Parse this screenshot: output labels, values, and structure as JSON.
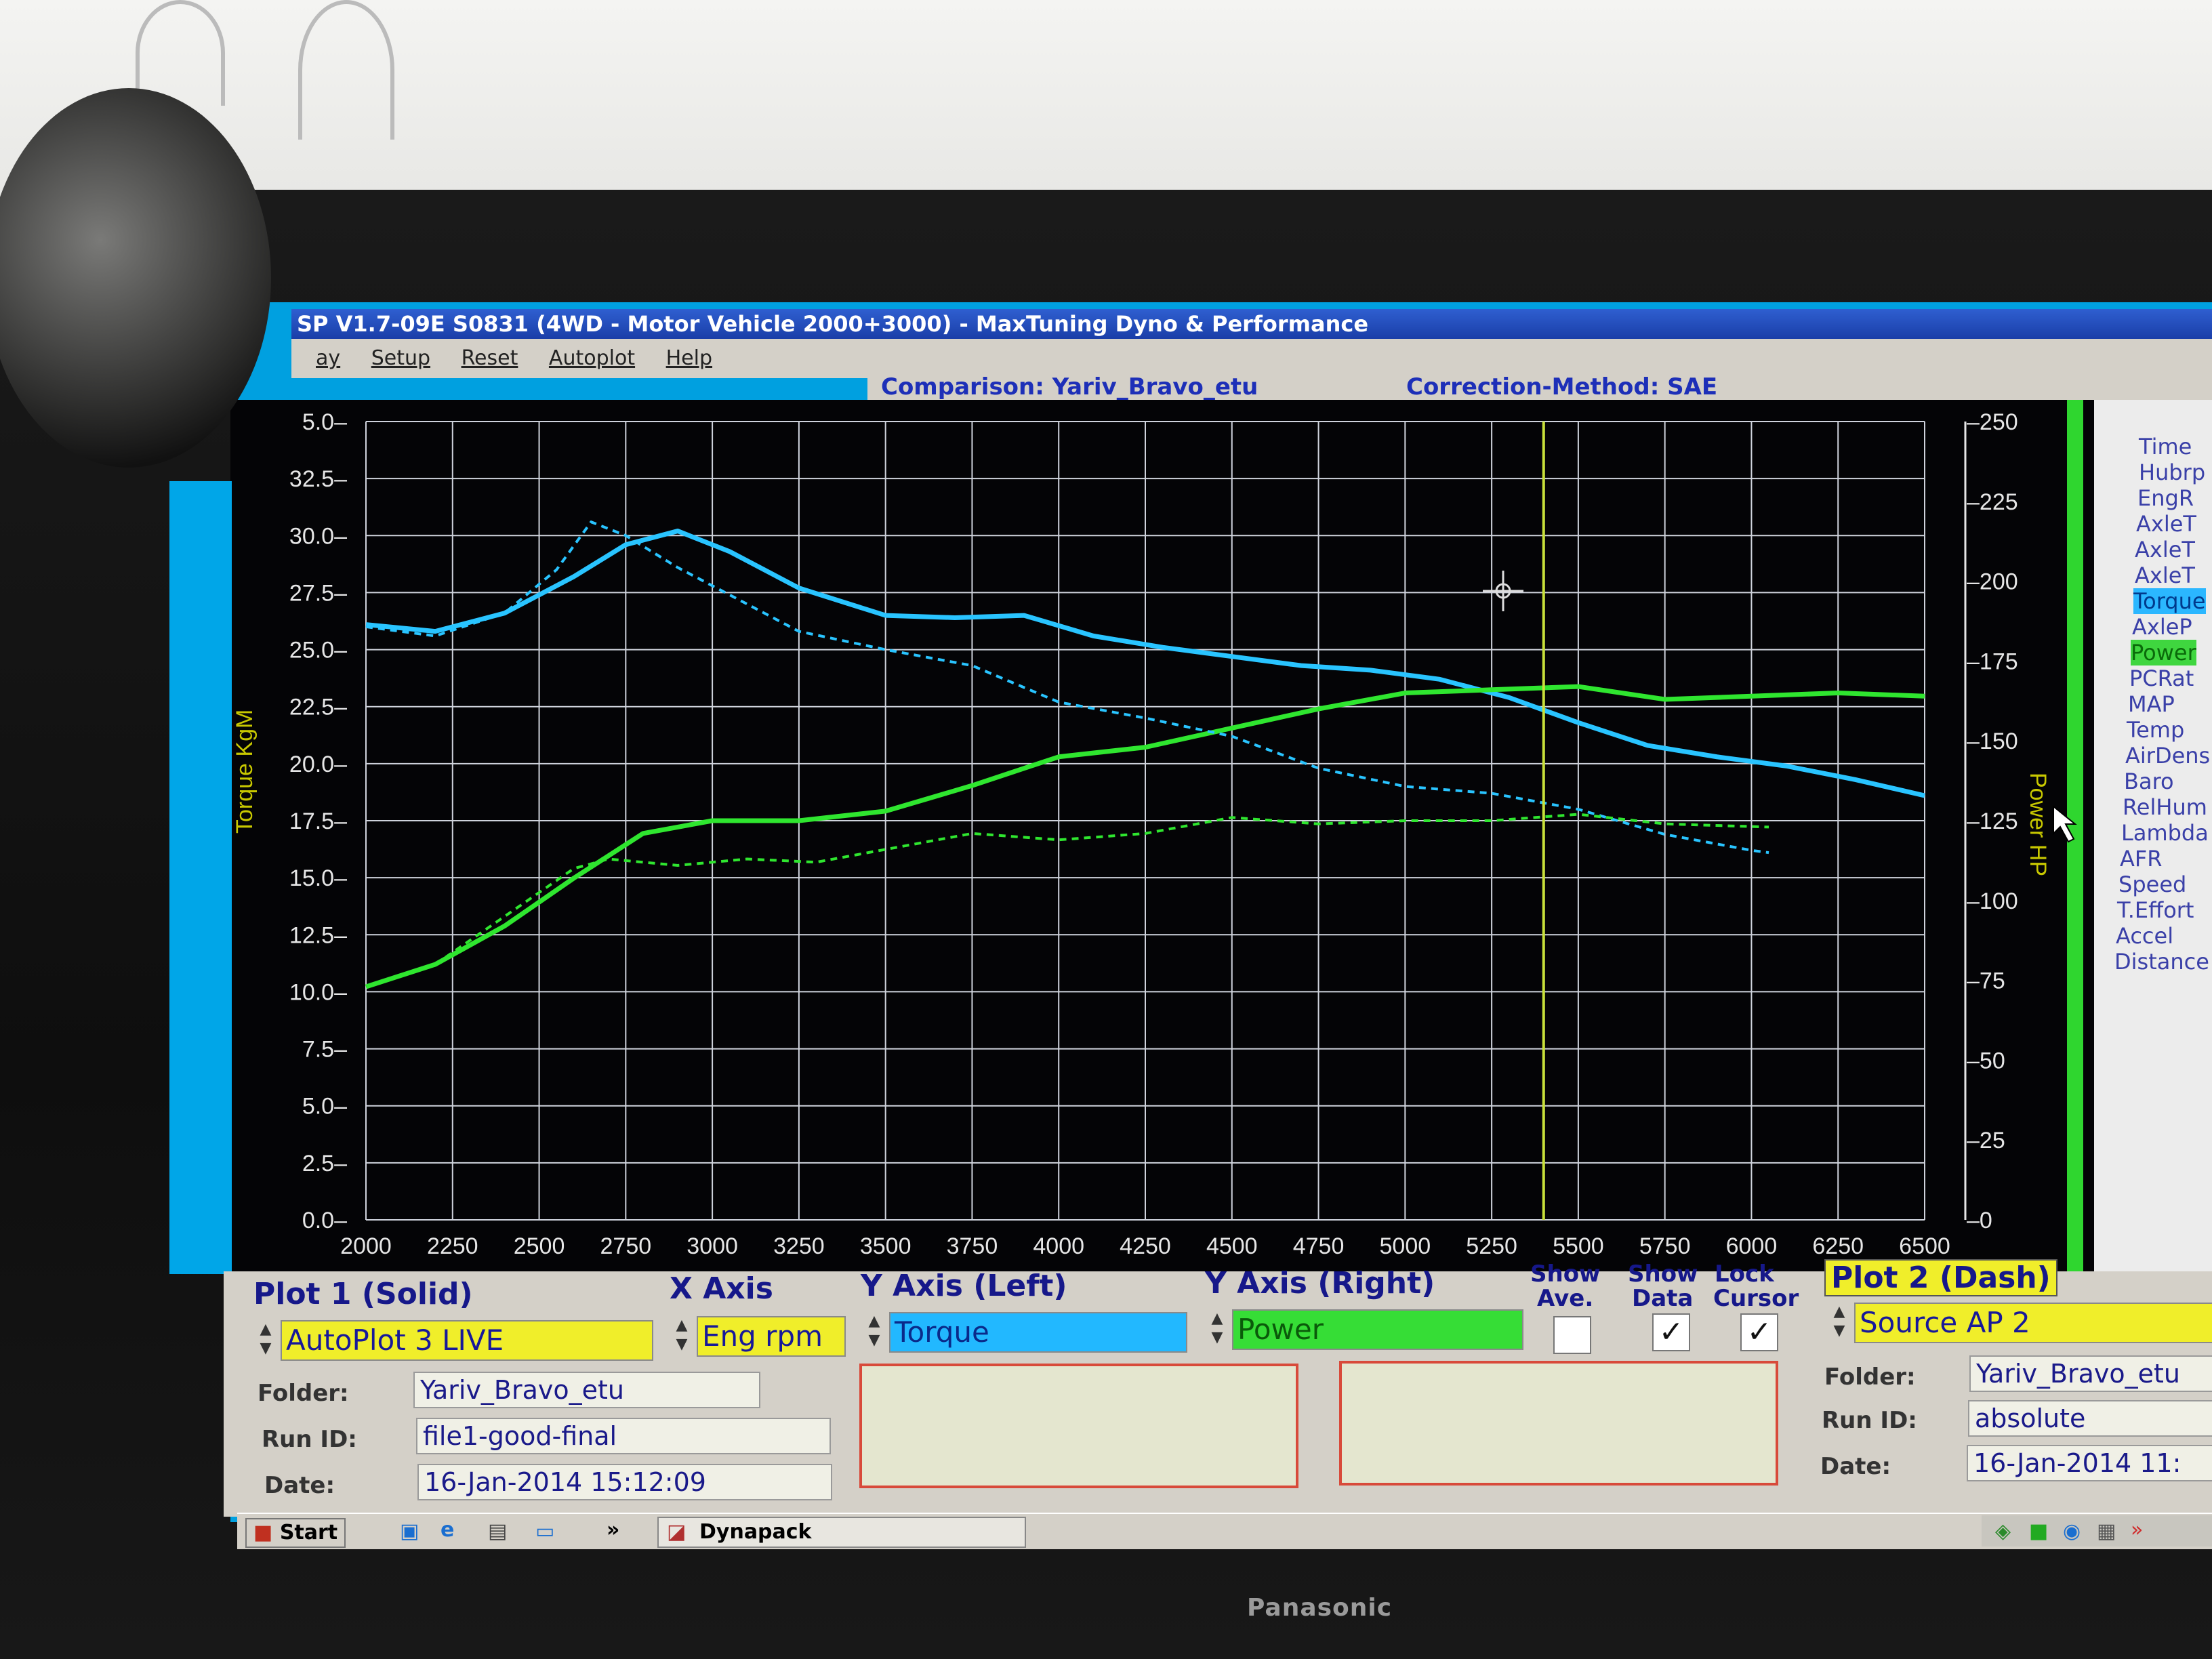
{
  "window": {
    "title": "SP V1.7-09E S0831  (4WD - Motor Vehicle 2000+3000) - MaxTuning Dyno & Performance",
    "menu": [
      "ay",
      "Setup",
      "Reset",
      "Autoplot",
      "Help"
    ]
  },
  "info": {
    "comparison": "Comparison: Yariv_Bravo_etu",
    "correction": "Correction-Method: SAE"
  },
  "channels": [
    "Time",
    "Hubrp",
    "EngR",
    "AxleT",
    "AxleT",
    "AxleT",
    "Torque",
    "AxleP",
    "Power",
    "PCRat",
    "MAP",
    "Temp",
    "AirDens",
    "Baro",
    "RelHum",
    "Lambda",
    "AFR",
    "Speed",
    "T.Effort",
    "Accel",
    "Distance"
  ],
  "chart_data": {
    "type": "line",
    "ylabel": "Torque KgM",
    "y2label": "Power HP",
    "xlim": [
      2000,
      6500
    ],
    "ylim": [
      0,
      35
    ],
    "y2lim": [
      0,
      250
    ],
    "x_ticks": [
      "2000",
      "2250",
      "2500",
      "2750",
      "3000",
      "3250",
      "3500",
      "3750",
      "4000",
      "4250",
      "4500",
      "4750",
      "5000",
      "5250",
      "5500",
      "5750",
      "6000",
      "6250",
      "6500"
    ],
    "y_ticks": [
      "0.0",
      "2.5",
      "5.0",
      "7.5",
      "10.0",
      "12.5",
      "15.0",
      "17.5",
      "20.0",
      "22.5",
      "25.0",
      "27.5",
      "30.0",
      "32.5",
      "5.0"
    ],
    "y2_ticks": [
      "0",
      "25",
      "50",
      "75",
      "100",
      "125",
      "150",
      "175",
      "200",
      "225",
      "250"
    ],
    "grid": true,
    "cursor_x": 5400,
    "colors": {
      "torque": "#29c4ff",
      "power": "#2fe62f",
      "cursor": "#c8e03a"
    },
    "series": [
      {
        "name": "Torque",
        "axis": "left",
        "style": "solid",
        "x": [
          2000,
          2200,
          2400,
          2600,
          2750,
          2900,
          3050,
          3250,
          3500,
          3700,
          3900,
          4100,
          4300,
          4500,
          4700,
          4900,
          5100,
          5300,
          5500,
          5700,
          5900,
          6100,
          6300,
          6500
        ],
        "y": [
          26.1,
          25.8,
          26.6,
          28.2,
          29.6,
          30.2,
          29.3,
          27.7,
          26.5,
          26.4,
          26.5,
          25.6,
          25.1,
          24.7,
          24.3,
          24.1,
          23.7,
          22.9,
          21.8,
          20.8,
          20.3,
          19.9,
          19.3,
          18.6
        ]
      },
      {
        "name": "Power",
        "axis": "right",
        "style": "solid",
        "x": [
          2000,
          2200,
          2400,
          2600,
          2800,
          3000,
          3250,
          3500,
          3750,
          4000,
          4250,
          4500,
          4750,
          5000,
          5250,
          5500,
          5750,
          6000,
          6250,
          6500
        ],
        "y": [
          73,
          80,
          92,
          107,
          121,
          125,
          125,
          128,
          136,
          145,
          148,
          154,
          160,
          165,
          166,
          167,
          163,
          164,
          165,
          164
        ]
      },
      {
        "name": "Torque (Plot 2)",
        "axis": "left",
        "style": "dash",
        "x": [
          2000,
          2200,
          2400,
          2550,
          2650,
          2750,
          2900,
          3050,
          3250,
          3500,
          3750,
          4000,
          4250,
          4500,
          4750,
          5000,
          5250,
          5500,
          5750,
          6000,
          6050
        ],
        "y": [
          26.0,
          25.6,
          26.6,
          28.5,
          30.6,
          30.0,
          28.6,
          27.4,
          25.8,
          25.0,
          24.3,
          22.7,
          22.0,
          21.2,
          19.8,
          19.0,
          18.7,
          18.0,
          16.9,
          16.2,
          16.1
        ]
      },
      {
        "name": "Power (Plot 2)",
        "axis": "right",
        "style": "dash",
        "x": [
          2000,
          2200,
          2400,
          2600,
          2700,
          2900,
          3100,
          3300,
          3500,
          3750,
          4000,
          4250,
          4500,
          4750,
          5000,
          5250,
          5500,
          5750,
          6050
        ],
        "y": [
          73,
          80,
          95,
          110,
          113,
          111,
          113,
          112,
          116,
          121,
          119,
          121,
          126,
          124,
          125,
          125,
          127,
          124,
          123
        ]
      }
    ]
  },
  "bottom": {
    "plot1": {
      "label": "Plot 1 (Solid)",
      "source": "AutoPlot 3 LIVE"
    },
    "xaxis": {
      "label": "X Axis",
      "value": "Eng rpm"
    },
    "yleft": {
      "label": "Y Axis (Left)",
      "value": "Torque"
    },
    "yright": {
      "label": "Y Axis (Right)",
      "value": "Power"
    },
    "show_ave": {
      "line1": "Show",
      "line2": "Ave.",
      "checked": false
    },
    "show_data": {
      "line1": "Show",
      "line2": "Data",
      "checked": true
    },
    "lock_cursor": {
      "line1": "Lock",
      "line2": "Cursor",
      "checked": true
    },
    "plot2": {
      "label": "Plot 2 (Dash)",
      "source": "Source AP 2"
    },
    "folder_label": "Folder:",
    "runid_label": "Run ID:",
    "date_label": "Date:",
    "left": {
      "folder": "Yariv_Bravo_etu",
      "runid": "file1-good-final",
      "date": "16-Jan-2014  15:12:09"
    },
    "right": {
      "folder": "Yariv_Bravo_etu",
      "runid": "absolute",
      "date": "16-Jan-2014  11:"
    },
    "check_mark": "✓"
  },
  "taskbar": {
    "start": "Start",
    "more": "»",
    "task": "Dynapack"
  },
  "monitor": {
    "brand": "Panasonic"
  }
}
